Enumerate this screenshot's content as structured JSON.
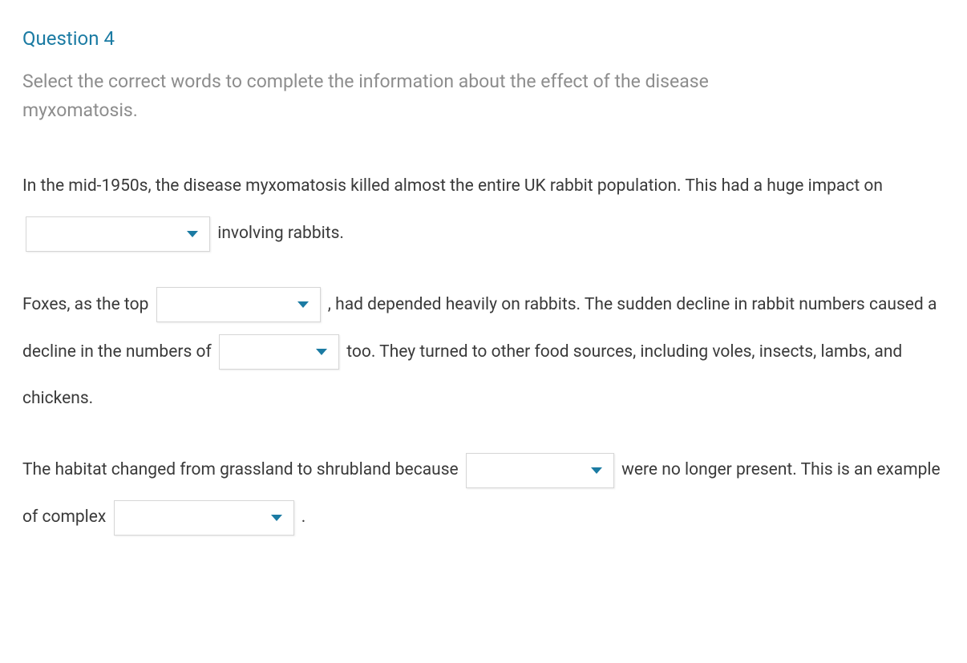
{
  "title": "Question 4",
  "instruction": "Select the correct words to complete the information about the effect of the disease myxomatosis.",
  "passage": {
    "p1a": "In the mid-1950s, the disease myxomatosis killed almost the entire UK rabbit population. This had a huge impact on ",
    "p1b": " involving rabbits.",
    "p2a": "Foxes, as the top ",
    "p2b": " , had depended heavily on rabbits. The sudden decline in rabbit numbers caused a decline in the numbers of ",
    "p2c": " too. They turned to other food sources, including voles, insects, lambs, and chickens.",
    "p3a": "The habitat changed from grassland to shrubland because ",
    "p3b": " were no longer present. This is an example of complex ",
    "p3c": " ."
  },
  "dropdowns": {
    "d1": {
      "selected": ""
    },
    "d2": {
      "selected": ""
    },
    "d3": {
      "selected": ""
    },
    "d4": {
      "selected": ""
    },
    "d5": {
      "selected": ""
    }
  }
}
